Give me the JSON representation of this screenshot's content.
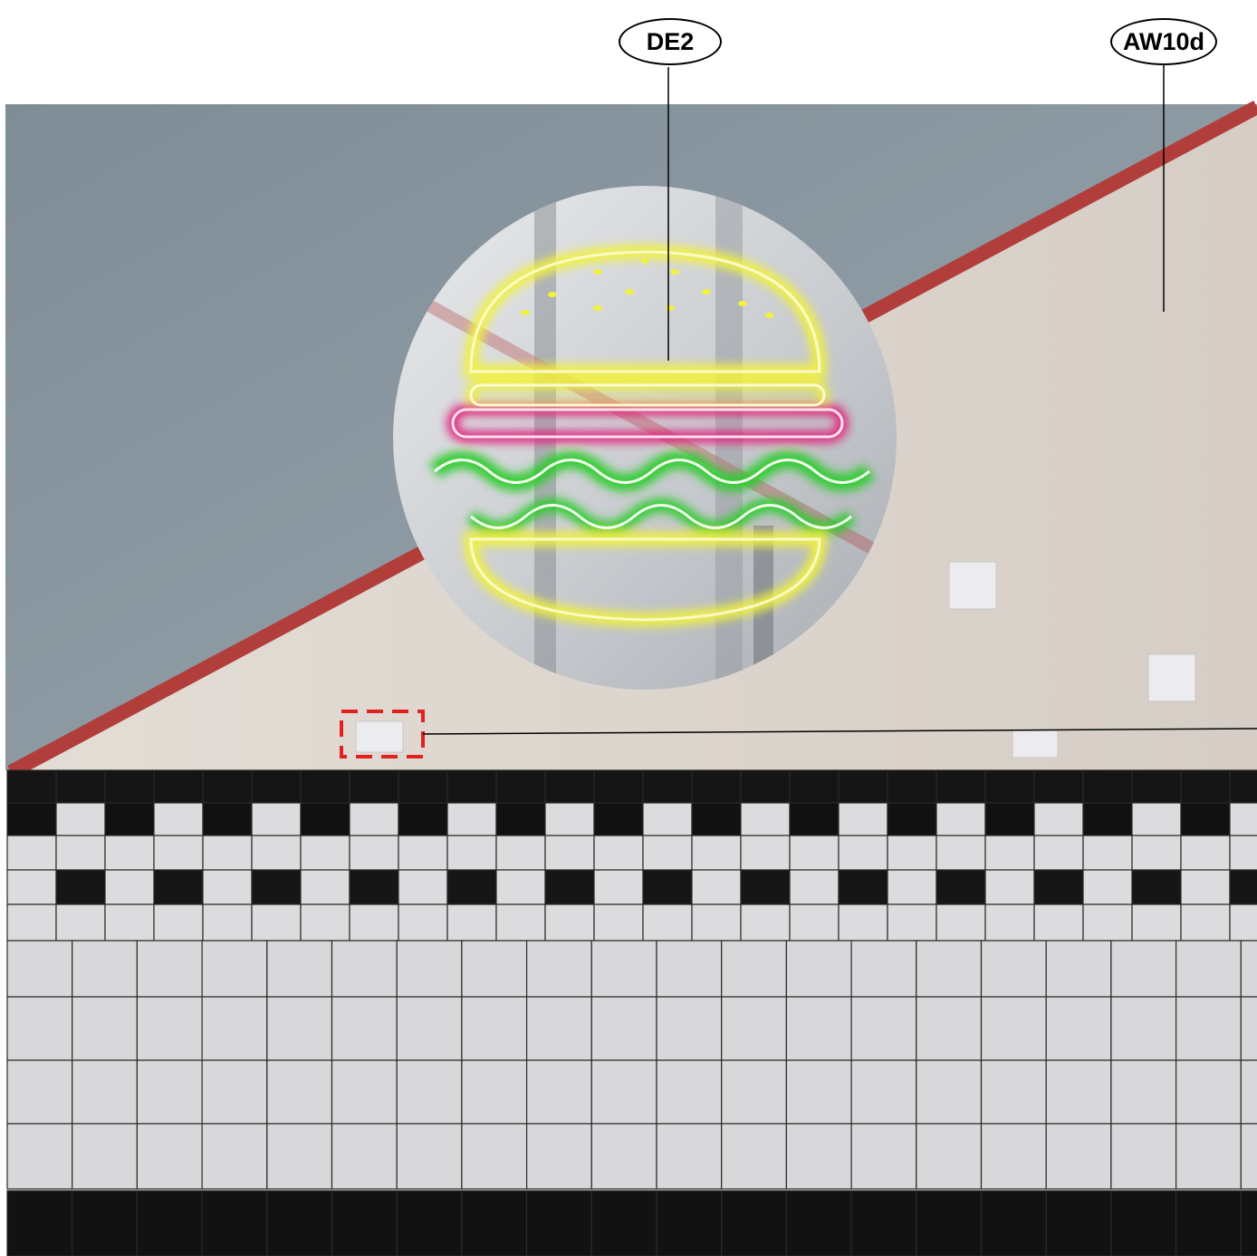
{
  "callouts": {
    "de2": {
      "label": "DE2"
    },
    "aw10d": {
      "label": "AW10d"
    }
  },
  "colors": {
    "wall_upper": "#8e9ba4",
    "wall_panel": "#ded7d0",
    "red_stripe": "#b23e3c",
    "tile_white": "#d9d9dc",
    "tile_black": "#151515",
    "grout": "#2a2a2a",
    "neon_yellow": "#f2f23a",
    "neon_pink": "#e0207a",
    "neon_green": "#2ccc2a",
    "highlight_box": "#e32020"
  }
}
